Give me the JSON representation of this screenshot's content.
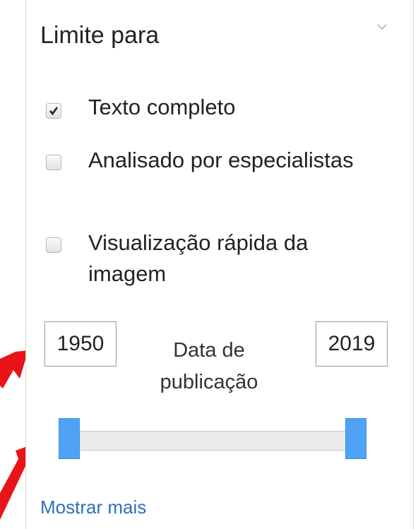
{
  "panel": {
    "title": "Limite para",
    "collapse_icon": "chevron-down-icon"
  },
  "filters": [
    {
      "label": "Texto completo",
      "checked": true
    },
    {
      "label": "Analisado por especialistas",
      "checked": false
    },
    {
      "label": "Visualização rápida da imagem",
      "checked": false
    }
  ],
  "date_range": {
    "start": "1950",
    "end": "2019",
    "label": "Data de publicação",
    "slider_min_fraction": 0.0,
    "slider_max_fraction": 1.0,
    "handle_color": "#4fa3f7"
  },
  "show_more": "Mostrar mais",
  "annotations": {
    "arrow_color": "#e8141a",
    "arrow_icon": "red-arrow-icon"
  }
}
